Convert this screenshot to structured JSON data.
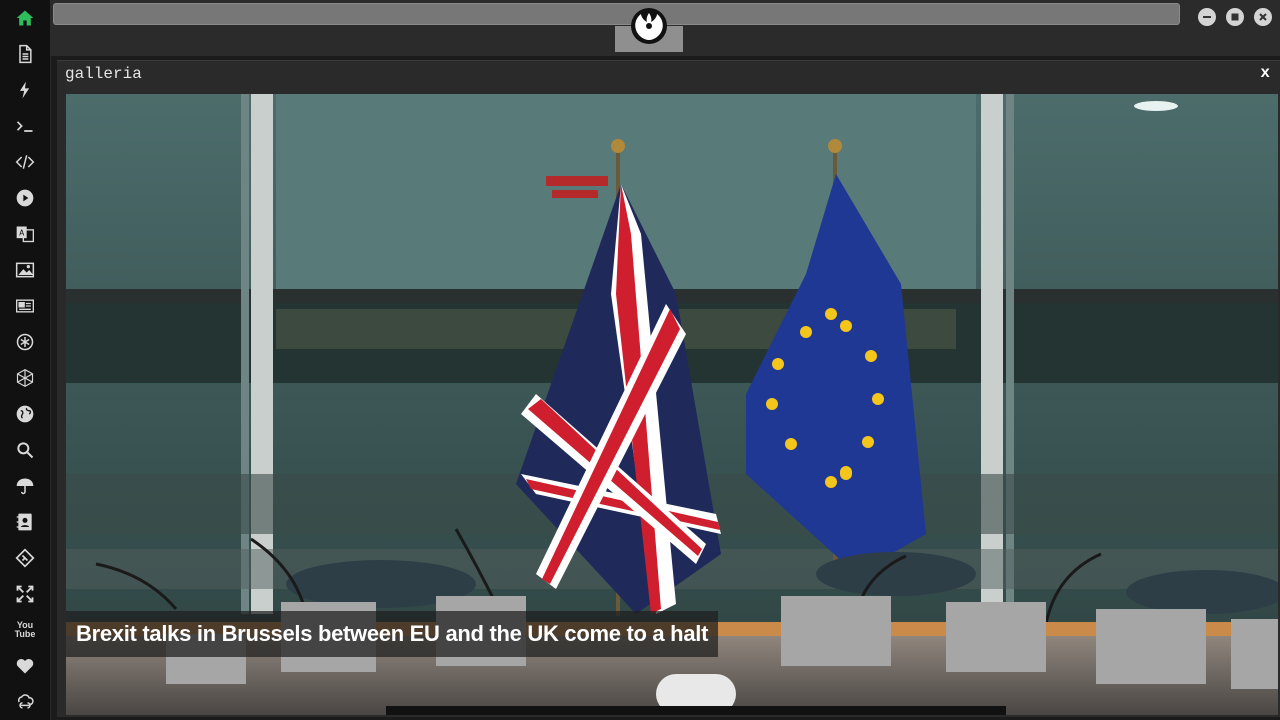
{
  "panel": {
    "title": "galleria",
    "close_label": "x"
  },
  "gallery": {
    "caption": "Brexit talks in Brussels between EU and the UK come to a halt"
  },
  "rail": {
    "items": [
      {
        "icon": "home-icon",
        "active": true
      },
      {
        "icon": "document-icon"
      },
      {
        "icon": "lightning-icon"
      },
      {
        "icon": "terminal-icon"
      },
      {
        "icon": "code-icon"
      },
      {
        "icon": "play-icon"
      },
      {
        "icon": "translate-icon"
      },
      {
        "icon": "image-icon"
      },
      {
        "icon": "newspaper-icon"
      },
      {
        "icon": "rebel-alliance-icon"
      },
      {
        "icon": "hexagon-network-icon"
      },
      {
        "icon": "globe-icon"
      },
      {
        "icon": "search-icon"
      },
      {
        "icon": "umbrella-icon"
      },
      {
        "icon": "contact-card-icon"
      },
      {
        "icon": "git-diamond-icon"
      },
      {
        "icon": "expand-icon"
      },
      {
        "icon": "youtube-icon",
        "label_top": "You",
        "label_bottom": "Tube"
      },
      {
        "icon": "heart-icon"
      },
      {
        "icon": "cloud-link-icon"
      }
    ]
  },
  "colors": {
    "accent": "#2ebd5b",
    "rail_bg": "#111111",
    "topbar_bg": "#2b2b2b"
  }
}
